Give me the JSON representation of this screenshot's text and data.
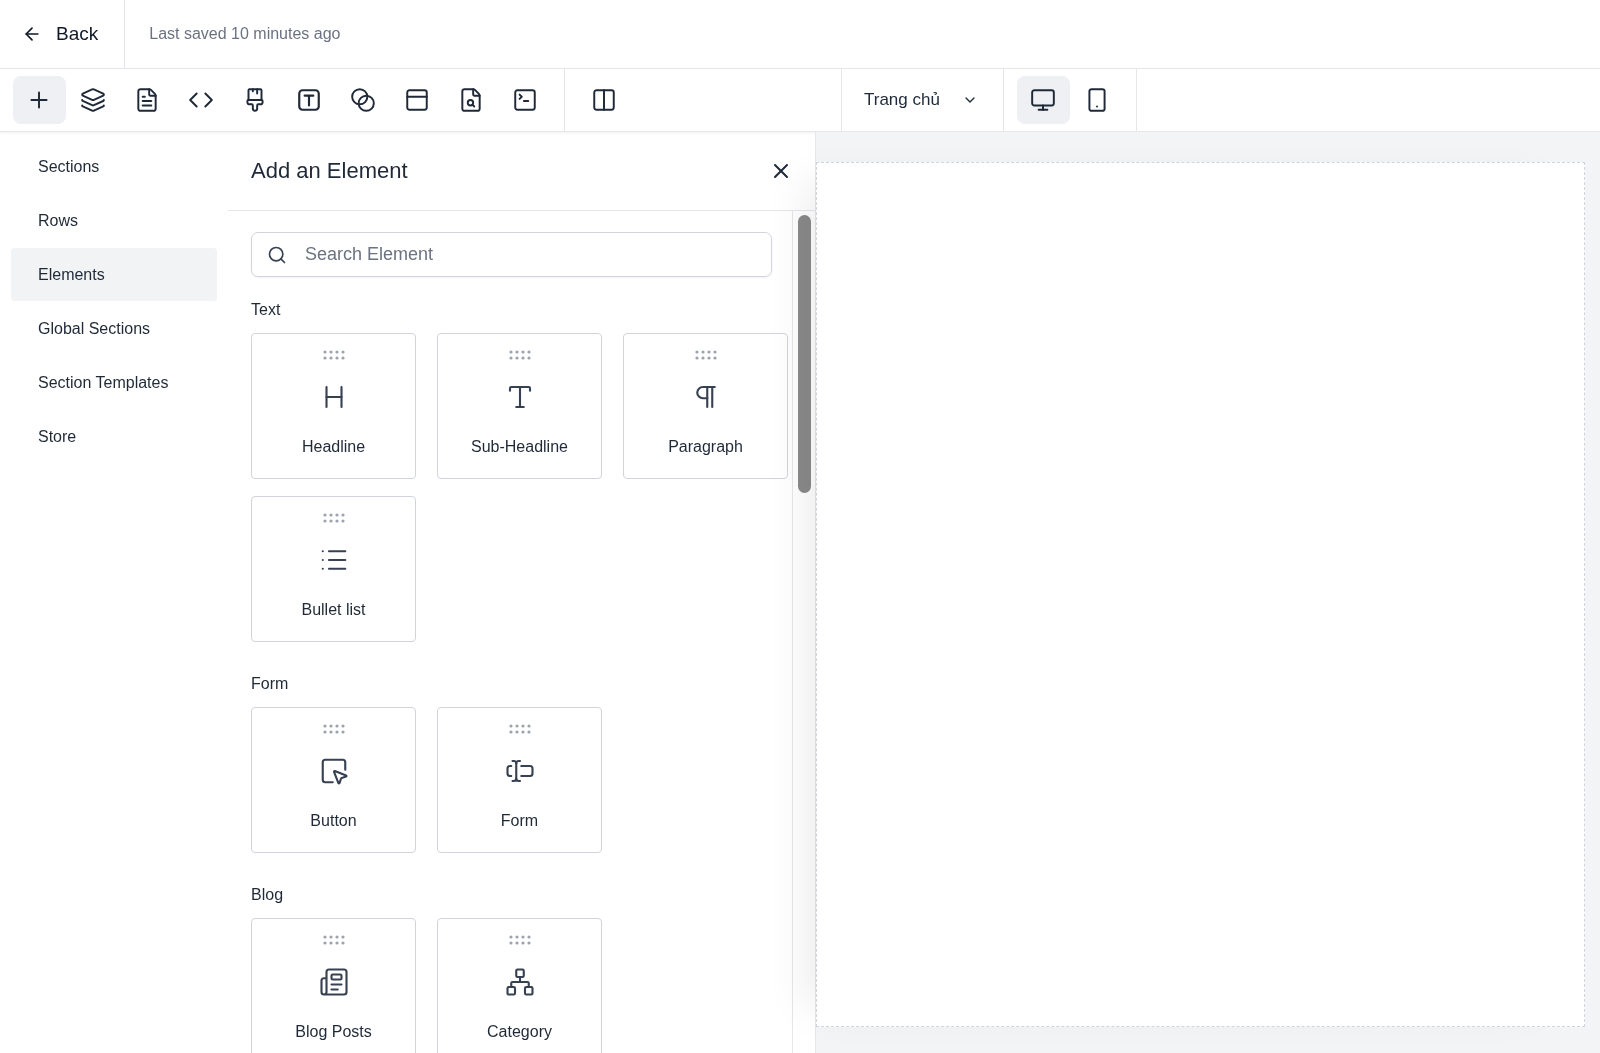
{
  "header": {
    "back": "Back",
    "saved": "Last saved 10 minutes ago"
  },
  "toolbar": {
    "tools": [
      {
        "kind": "plus",
        "selected": true
      },
      {
        "kind": "layers",
        "selected": false
      },
      {
        "kind": "page",
        "selected": false
      },
      {
        "kind": "code",
        "selected": false
      },
      {
        "kind": "brush",
        "selected": false
      },
      {
        "kind": "text",
        "selected": false
      },
      {
        "kind": "blend",
        "selected": false
      },
      {
        "kind": "window",
        "selected": false
      },
      {
        "kind": "search-page",
        "selected": false
      },
      {
        "kind": "terminal",
        "selected": false
      }
    ],
    "layout_tool": {
      "kind": "columns",
      "selected": false
    },
    "page_select": "Trang chủ",
    "devices": [
      {
        "kind": "desktop",
        "selected": true
      },
      {
        "kind": "mobile",
        "selected": false
      }
    ]
  },
  "sidebar": {
    "items": [
      {
        "label": "Sections",
        "selected": false
      },
      {
        "label": "Rows",
        "selected": false
      },
      {
        "label": "Elements",
        "selected": true
      },
      {
        "label": "Global Sections",
        "selected": false
      },
      {
        "label": "Section Templates",
        "selected": false
      },
      {
        "label": "Store",
        "selected": false
      }
    ]
  },
  "panel": {
    "title": "Add an Element",
    "search": {
      "placeholder": "Search Element"
    },
    "groups": [
      {
        "title": "Text",
        "items": [
          {
            "label": "Headline",
            "kind": "heading"
          },
          {
            "label": "Sub-Headline",
            "kind": "type"
          },
          {
            "label": "Paragraph",
            "kind": "pilcrow"
          },
          {
            "label": "Bullet list",
            "kind": "list"
          }
        ]
      },
      {
        "title": "Form",
        "items": [
          {
            "label": "Button",
            "kind": "button"
          },
          {
            "label": "Form",
            "kind": "input"
          }
        ]
      },
      {
        "title": "Blog",
        "items": [
          {
            "label": "Blog Posts",
            "kind": "posts"
          },
          {
            "label": "Category",
            "kind": "category"
          }
        ]
      }
    ]
  }
}
